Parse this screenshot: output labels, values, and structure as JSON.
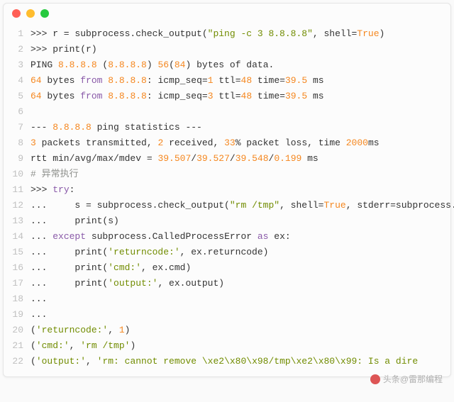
{
  "code": {
    "lines": [
      {
        "n": "1",
        "seg": [
          {
            "t": ">>> r = subprocess.check_output("
          },
          {
            "t": "\"ping -c 3 8.8.8.8\"",
            "c": "tok-str"
          },
          {
            "t": ", shell="
          },
          {
            "t": "True",
            "c": "tok-bool"
          },
          {
            "t": ")"
          }
        ]
      },
      {
        "n": "2",
        "seg": [
          {
            "t": ">>> print(r)"
          }
        ]
      },
      {
        "n": "3",
        "seg": [
          {
            "t": "PING "
          },
          {
            "t": "8.8.8.8",
            "c": "tok-ip"
          },
          {
            "t": " ("
          },
          {
            "t": "8.8.8.8",
            "c": "tok-ip"
          },
          {
            "t": ") "
          },
          {
            "t": "56",
            "c": "tok-num"
          },
          {
            "t": "("
          },
          {
            "t": "84",
            "c": "tok-num"
          },
          {
            "t": ") bytes of data."
          }
        ]
      },
      {
        "n": "4",
        "seg": [
          {
            "t": "64",
            "c": "tok-num"
          },
          {
            "t": " bytes "
          },
          {
            "t": "from",
            "c": "tok-kw"
          },
          {
            "t": " "
          },
          {
            "t": "8.8.8.8",
            "c": "tok-ip"
          },
          {
            "t": ": icmp_seq="
          },
          {
            "t": "1",
            "c": "tok-num"
          },
          {
            "t": " ttl="
          },
          {
            "t": "48",
            "c": "tok-num"
          },
          {
            "t": " time="
          },
          {
            "t": "39.5",
            "c": "tok-num"
          },
          {
            "t": " ms"
          }
        ]
      },
      {
        "n": "5",
        "seg": [
          {
            "t": "64",
            "c": "tok-num"
          },
          {
            "t": " bytes "
          },
          {
            "t": "from",
            "c": "tok-kw"
          },
          {
            "t": " "
          },
          {
            "t": "8.8.8.8",
            "c": "tok-ip"
          },
          {
            "t": ": icmp_seq="
          },
          {
            "t": "3",
            "c": "tok-num"
          },
          {
            "t": " ttl="
          },
          {
            "t": "48",
            "c": "tok-num"
          },
          {
            "t": " time="
          },
          {
            "t": "39.5",
            "c": "tok-num"
          },
          {
            "t": " ms"
          }
        ]
      },
      {
        "n": "6",
        "seg": [
          {
            "t": ""
          }
        ]
      },
      {
        "n": "7",
        "seg": [
          {
            "t": "--- "
          },
          {
            "t": "8.8.8.8",
            "c": "tok-ip"
          },
          {
            "t": " ping statistics ---"
          }
        ]
      },
      {
        "n": "8",
        "seg": [
          {
            "t": "3",
            "c": "tok-num"
          },
          {
            "t": " packets transmitted, "
          },
          {
            "t": "2",
            "c": "tok-num"
          },
          {
            "t": " received, "
          },
          {
            "t": "33",
            "c": "tok-num"
          },
          {
            "t": "% packet loss, time "
          },
          {
            "t": "2000",
            "c": "tok-num"
          },
          {
            "t": "ms"
          }
        ]
      },
      {
        "n": "9",
        "seg": [
          {
            "t": "rtt min/avg/max/mdev = "
          },
          {
            "t": "39.507",
            "c": "tok-num"
          },
          {
            "t": "/"
          },
          {
            "t": "39.527",
            "c": "tok-num"
          },
          {
            "t": "/"
          },
          {
            "t": "39.548",
            "c": "tok-num"
          },
          {
            "t": "/"
          },
          {
            "t": "0.199",
            "c": "tok-num"
          },
          {
            "t": " ms"
          }
        ]
      },
      {
        "n": "10",
        "seg": [
          {
            "t": "# 异常执行",
            "c": "tok-com"
          }
        ]
      },
      {
        "n": "11",
        "seg": [
          {
            "t": ">>> "
          },
          {
            "t": "try",
            "c": "tok-kw"
          },
          {
            "t": ":"
          }
        ]
      },
      {
        "n": "12",
        "seg": [
          {
            "t": "...     s = subprocess.check_output("
          },
          {
            "t": "\"rm /tmp\"",
            "c": "tok-str"
          },
          {
            "t": ", shell="
          },
          {
            "t": "True",
            "c": "tok-bool"
          },
          {
            "t": ", stderr=subprocess.STDOUT)"
          }
        ]
      },
      {
        "n": "13",
        "seg": [
          {
            "t": "...     print(s)"
          }
        ]
      },
      {
        "n": "14",
        "seg": [
          {
            "t": "... "
          },
          {
            "t": "except",
            "c": "tok-kw"
          },
          {
            "t": " subprocess.CalledProcessError "
          },
          {
            "t": "as",
            "c": "tok-kw"
          },
          {
            "t": " ex:"
          }
        ]
      },
      {
        "n": "15",
        "seg": [
          {
            "t": "...     print("
          },
          {
            "t": "'returncode:'",
            "c": "tok-str"
          },
          {
            "t": ", ex.returncode)"
          }
        ]
      },
      {
        "n": "16",
        "seg": [
          {
            "t": "...     print("
          },
          {
            "t": "'cmd:'",
            "c": "tok-str"
          },
          {
            "t": ", ex.cmd)"
          }
        ]
      },
      {
        "n": "17",
        "seg": [
          {
            "t": "...     print("
          },
          {
            "t": "'output:'",
            "c": "tok-str"
          },
          {
            "t": ", ex.output)"
          }
        ]
      },
      {
        "n": "18",
        "seg": [
          {
            "t": "..."
          }
        ]
      },
      {
        "n": "19",
        "seg": [
          {
            "t": "..."
          }
        ]
      },
      {
        "n": "20",
        "seg": [
          {
            "t": "("
          },
          {
            "t": "'returncode:'",
            "c": "tok-str"
          },
          {
            "t": ", "
          },
          {
            "t": "1",
            "c": "tok-num"
          },
          {
            "t": ")"
          }
        ]
      },
      {
        "n": "21",
        "seg": [
          {
            "t": "("
          },
          {
            "t": "'cmd:'",
            "c": "tok-str"
          },
          {
            "t": ", "
          },
          {
            "t": "'rm /tmp'",
            "c": "tok-str"
          },
          {
            "t": ")"
          }
        ]
      },
      {
        "n": "22",
        "seg": [
          {
            "t": "("
          },
          {
            "t": "'output:'",
            "c": "tok-str"
          },
          {
            "t": ", "
          },
          {
            "t": "'rm: cannot remove \\xe2\\x80\\x98/tmp\\xe2\\x80\\x99: Is a dire",
            "c": "tok-str"
          }
        ]
      }
    ]
  },
  "watermark": {
    "text": "头条@雷那编程"
  }
}
